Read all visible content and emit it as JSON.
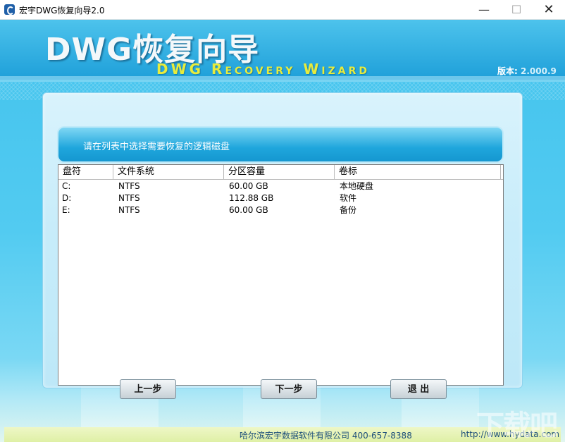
{
  "window": {
    "title": "宏宇DWG恢复向导2.0",
    "minimize_glyph": "—",
    "maximize_glyph": "☐",
    "close_glyph": "✕"
  },
  "header": {
    "title_cn": "DWG恢复向导",
    "title_en": "DWG Recovery Wizard",
    "version_label": "版本:",
    "version_value": "2.000.9"
  },
  "prompt": "请在列表中选择需要恢复的逻辑磁盘",
  "table": {
    "columns": [
      "盘符",
      "文件系统",
      "分区容量",
      "卷标"
    ],
    "rows": [
      [
        "C:",
        "NTFS",
        "60.00 GB",
        "本地硬盘"
      ],
      [
        "D:",
        "NTFS",
        "112.88 GB",
        "软件"
      ],
      [
        "E:",
        "NTFS",
        "60.00 GB",
        "备份"
      ]
    ]
  },
  "buttons": {
    "prev": "上一步",
    "next": "下一步",
    "exit": "退 出"
  },
  "footer": {
    "company": "哈尔滨宏宇数据软件有限公司 400-657-8388",
    "url": "http://www.hydata.com"
  },
  "watermark": "下载吧",
  "icons": {
    "app": "app-logo-icon"
  },
  "colors": {
    "header_blue": "#2fb0e4",
    "accent_yellow": "#e8ec3c",
    "prompt_blue": "#1fa6dc",
    "footer_bg": "#dff0a6"
  }
}
